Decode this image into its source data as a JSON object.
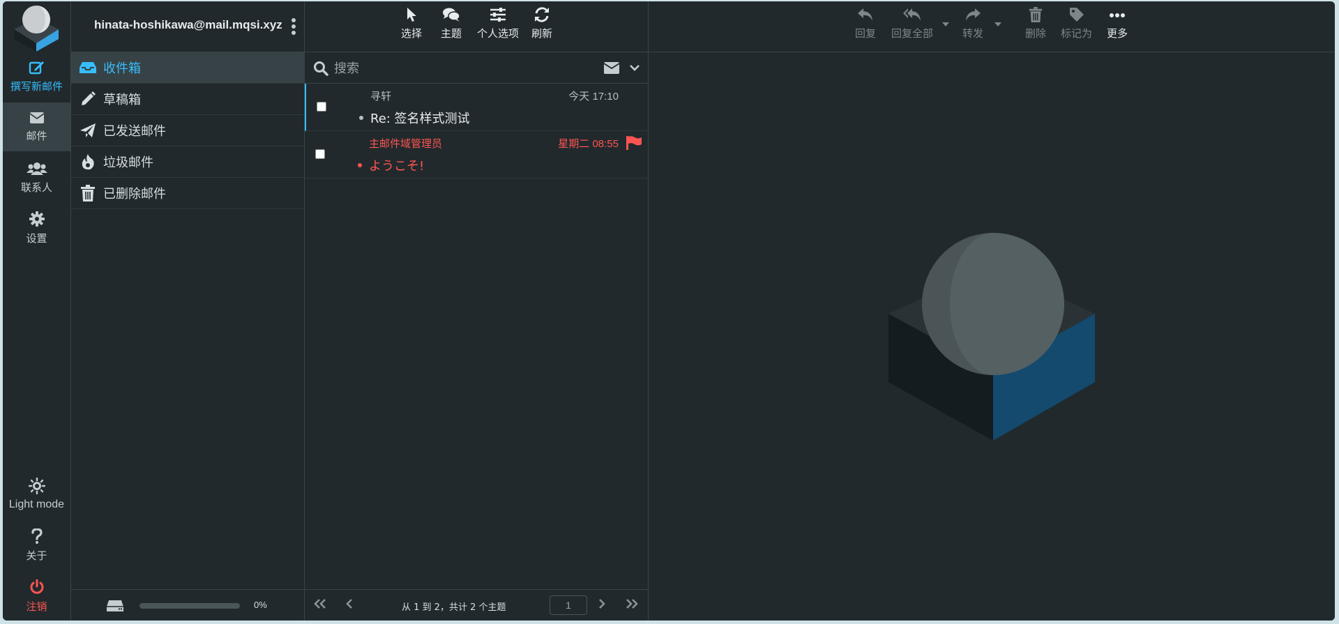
{
  "nav": {
    "compose": "撰写新邮件",
    "mail": "邮件",
    "contacts": "联系人",
    "settings": "设置",
    "light_mode": "Light mode",
    "about": "关于",
    "logout": "注销"
  },
  "account": {
    "email": "hinata-hoshikawa@mail.mqsi.xyz"
  },
  "folders": [
    {
      "label": "收件箱",
      "icon": "inbox-icon",
      "active": true
    },
    {
      "label": "草稿箱",
      "icon": "pencil-icon",
      "active": false
    },
    {
      "label": "已发送邮件",
      "icon": "paper-plane-icon",
      "active": false
    },
    {
      "label": "垃圾邮件",
      "icon": "fire-icon",
      "active": false
    },
    {
      "label": "已删除邮件",
      "icon": "trash-icon",
      "active": false
    }
  ],
  "quota": {
    "text": "0%",
    "value": 0
  },
  "list_toolbar": {
    "select": "选择",
    "threads": "主题",
    "options": "个人选项",
    "refresh": "刷新"
  },
  "search": {
    "placeholder": "搜索"
  },
  "messages": [
    {
      "from": "寻轩",
      "date": "今天 17:10",
      "subject": "Re: 签名样式测试",
      "flagged": false
    },
    {
      "from": "主邮件域管理员",
      "date": "星期二 08:55",
      "subject": "ようこそ!",
      "flagged": true
    }
  ],
  "pagination": {
    "text": "从 1 到 2，共计 2 个主题",
    "page": "1"
  },
  "preview_toolbar": {
    "reply": "回复",
    "reply_all": "回复全部",
    "forward": "转发",
    "delete": "删除",
    "mark": "标记为",
    "more": "更多"
  },
  "colors": {
    "accent": "#37beff",
    "danger": "#ff5552",
    "background": "#21292c",
    "active": "#374246"
  }
}
